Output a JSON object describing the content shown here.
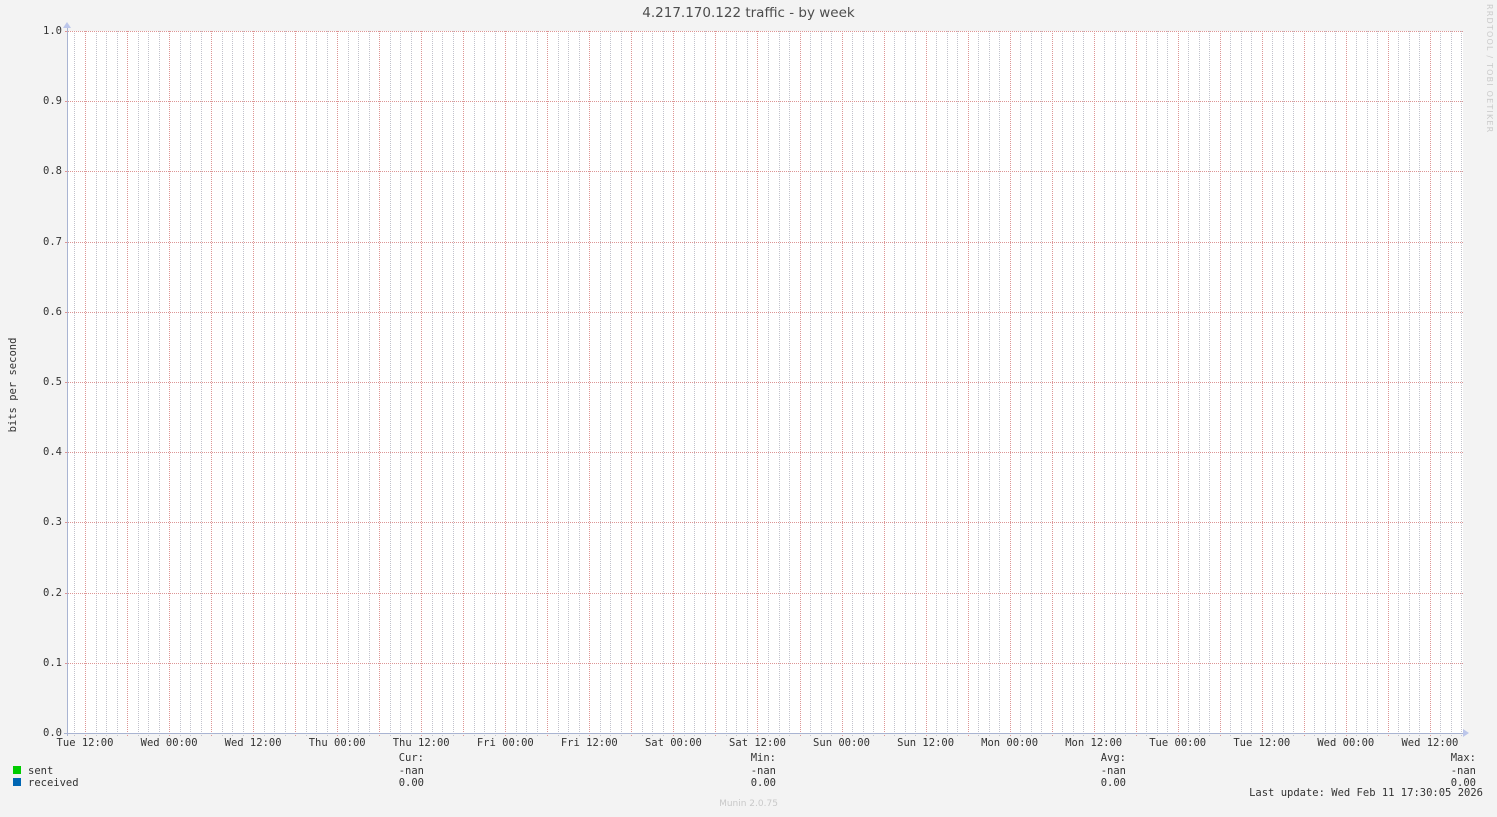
{
  "watermark_right": "RRDTOOL / TOBI OETIKER",
  "footer": {
    "last_update": "Last update: Wed Feb 11 17:30:05 2026",
    "munin_version": "Munin 2.0.75"
  },
  "chart_data": {
    "type": "line",
    "title": "4.217.170.122 traffic - by week",
    "xlabel": "",
    "ylabel": "bits per second",
    "ylim": [
      0.0,
      1.0
    ],
    "grid": true,
    "legend_position": "bottom",
    "y_ticks": [
      "1.0",
      "0.9",
      "0.8",
      "0.7",
      "0.6",
      "0.5",
      "0.4",
      "0.3",
      "0.2",
      "0.1",
      "0.0"
    ],
    "x_ticks": [
      "Tue 12:00",
      "Wed 00:00",
      "Wed 12:00",
      "Thu 00:00",
      "Thu 12:00",
      "Fri 00:00",
      "Fri 12:00",
      "Sat 00:00",
      "Sat 12:00",
      "Sun 00:00",
      "Sun 12:00",
      "Mon 00:00",
      "Mon 12:00",
      "Tue 00:00",
      "Tue 12:00",
      "Wed 00:00",
      "Wed 12:00"
    ],
    "series": [
      {
        "name": "sent",
        "color": "#00cc00",
        "values": []
      },
      {
        "name": "received",
        "color": "#0066b3",
        "values": []
      }
    ],
    "stats": {
      "headers": [
        "Cur:",
        "Min:",
        "Avg:",
        "Max:"
      ],
      "rows": [
        {
          "label": "sent",
          "color": "#00cc00",
          "values": [
            "-nan",
            "-nan",
            "-nan",
            "-nan"
          ]
        },
        {
          "label": "received",
          "color": "#0066b3",
          "values": [
            "0.00",
            "0.00",
            "0.00",
            "0.00"
          ]
        }
      ]
    }
  }
}
